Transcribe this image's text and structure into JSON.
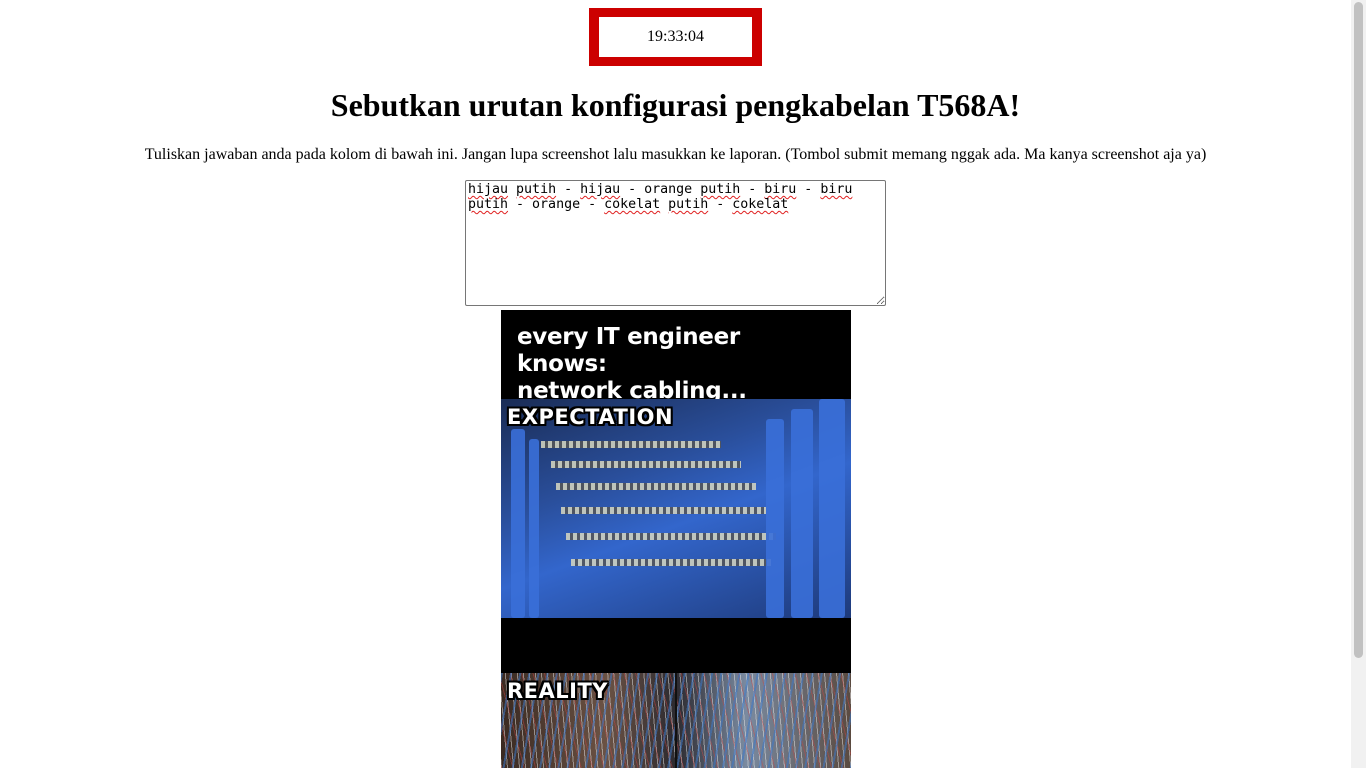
{
  "clock": {
    "time": "19:33:04"
  },
  "heading": "Sebutkan urutan konfigurasi pengkabelan T568A!",
  "instructions": "Tuliskan jawaban anda pada kolom di bawah ini. Jangan lupa screenshot lalu masukkan ke laporan. (Tombol submit memang nggak ada. Ma kanya screenshot aja ya)",
  "answer": {
    "value": "hijau putih - hijau - orange putih - biru - biru putih - orange - cokelat putih - cokelat"
  },
  "meme": {
    "caption_line1": "every IT engineer knows:",
    "caption_line2": "network cabling...",
    "label_expectation": "EXPECTATION",
    "label_reality": "REALITY"
  },
  "colors": {
    "clock_border": "#cc0000",
    "spellcheck_underline": "#e02020"
  }
}
